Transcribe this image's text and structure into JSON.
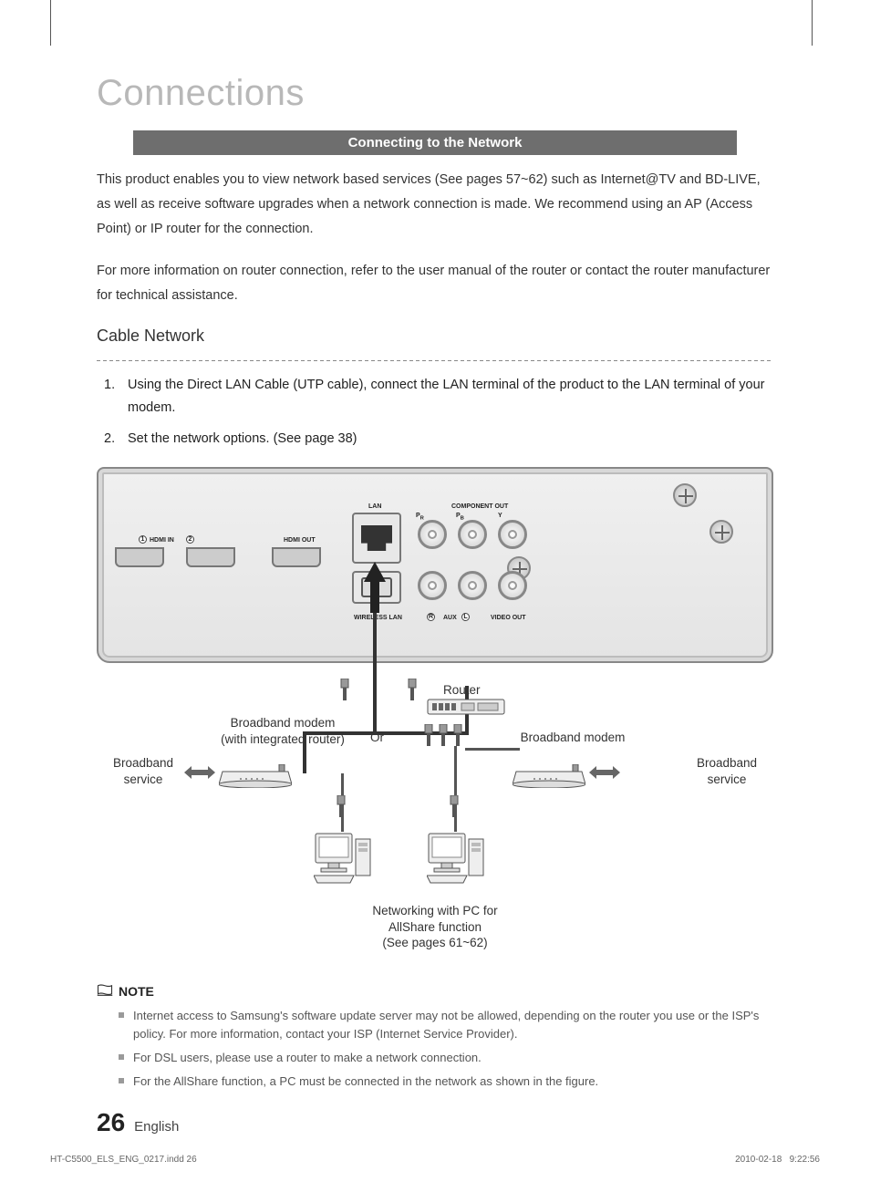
{
  "title": "Connections",
  "banner": "Connecting to the Network",
  "intro_p1": "This product enables you to view network based services (See pages 57~62) such as Internet@TV and BD-LIVE, as well as receive software upgrades when a network connection is made. We recommend using an AP (Access Point) or IP router for the connection.",
  "intro_p2": "For more information on router connection, refer to the user manual of the router or contact the router manufacturer for technical assistance.",
  "subheading": "Cable Network",
  "steps": [
    "Using the Direct LAN Cable (UTP cable), connect the LAN terminal of the product to the LAN terminal of your modem.",
    "Set the network options. (See page 38)"
  ],
  "diagram": {
    "ports": {
      "hdmi_in": "HDMI IN",
      "hdmi_in_1": "1",
      "hdmi_in_2": "2",
      "hdmi_out": "HDMI OUT",
      "lan": "LAN",
      "wireless_lan": "WIRELESS LAN",
      "component_out": "COMPONENT OUT",
      "comp_pr": "PR",
      "comp_pb": "PB",
      "comp_y": "Y",
      "aux": "AUX",
      "aux_r": "R",
      "aux_l": "L",
      "video_out": "VIDEO OUT"
    },
    "labels": {
      "router": "Router",
      "or": "Or",
      "broadband_modem_integrated_l1": "Broadband modem",
      "broadband_modem_integrated_l2": "(with integrated router)",
      "broadband_modem": "Broadband modem",
      "broadband_service": "Broadband\nservice",
      "networking_l1": "Networking with PC for",
      "networking_l2": "AllShare function",
      "networking_l3": "(See pages 61~62)"
    }
  },
  "note_label": "NOTE",
  "notes": [
    "Internet access to Samsung's software update server may not be allowed, depending on the router you use or the ISP's policy. For more information, contact your ISP (Internet Service Provider).",
    "For DSL users, please use a router to make a network connection.",
    "For the AllShare function, a PC must be connected in the network as shown in the figure."
  ],
  "footer": {
    "page": "26",
    "lang": "English"
  },
  "printfoot": {
    "file": "HT-C5500_ELS_ENG_0217.indd   26",
    "date": "2010-02-18",
    "time": "9:22:56"
  }
}
